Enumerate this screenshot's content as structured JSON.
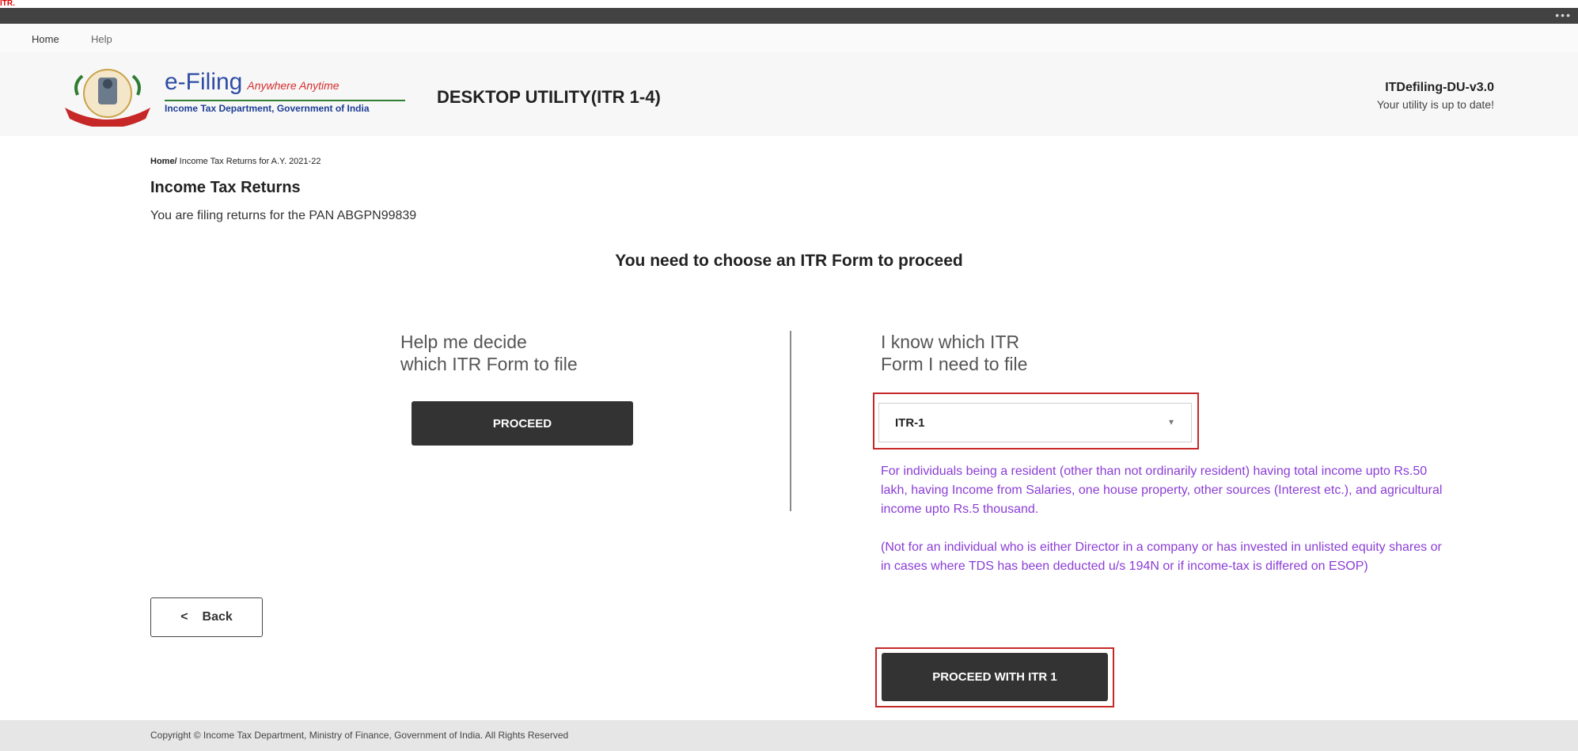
{
  "top_label": "ITR.",
  "titlebar": {
    "dots": "•••"
  },
  "menu": {
    "home": "Home",
    "help": "Help"
  },
  "header": {
    "brand_name": "e-Filing",
    "brand_tag": "Anywhere Anytime",
    "dept": "Income Tax Department, Government of India",
    "title": "DESKTOP UTILITY(ITR 1-4)",
    "version": "ITDefiling-DU-v3.0",
    "status": "Your utility is up to date!"
  },
  "breadcrumb": {
    "home": "Home/",
    "current": " Income Tax Returns for A.Y. 2021-22"
  },
  "page": {
    "title": "Income Tax Returns",
    "pan_text": "You are filing returns for the PAN ABGPN99839",
    "choose_text": "You need to choose an ITR Form to proceed"
  },
  "left": {
    "line1": "Help me decide",
    "line2": "which ITR Form to file",
    "button": "PROCEED"
  },
  "right": {
    "line1": "I know which ITR",
    "line2": "Form I need to file",
    "selected": "ITR-1",
    "caret": "▾",
    "desc1": "For individuals being a resident (other than not ordinarily resident) having total income upto Rs.50 lakh, having Income from Salaries, one house property, other sources (Interest etc.), and agricultural income upto Rs.5 thousand.",
    "desc2": "(Not for an individual who is either Director in a company or has invested in unlisted equity shares or in  cases where TDS  has been deducted u/s 194N or if income-tax is differed on ESOP)",
    "button": "PROCEED WITH ITR 1"
  },
  "back": {
    "chevron": "<",
    "label": "Back"
  },
  "footer": {
    "text": "Copyright © Income Tax Department, Ministry of Finance, Government of India. All Rights Reserved"
  }
}
